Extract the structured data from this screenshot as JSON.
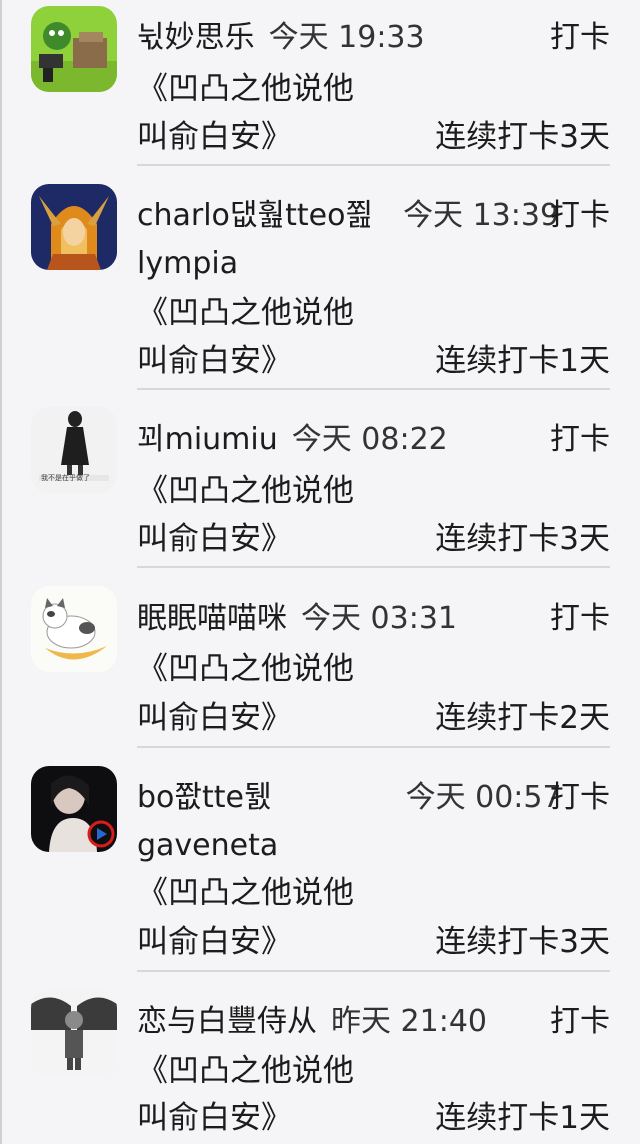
{
  "entries": [
    {
      "avatar_icon": "avatar-green-cartoon-icon",
      "name": "뉛妙思乐",
      "name_cont": "",
      "time": "今天 19:33",
      "action": "打卡",
      "book_line1": "《凹凸之他说他",
      "book_line2": "叫俞白安》",
      "streak": "连续打卡3天"
    },
    {
      "avatar_icon": "avatar-fantasy-portrait-icon",
      "name": "charlo댒훮tteo쬞",
      "name_cont": "lympia",
      "time": "今天 13:39",
      "action": "打卡",
      "book_line1": "《凹凸之他说他",
      "book_line2": "叫俞白安》",
      "streak": "连续打卡1天"
    },
    {
      "avatar_icon": "avatar-figure-sketch-icon",
      "name": "꾀miumiu",
      "name_cont": "",
      "time": "今天 08:22",
      "action": "打卡",
      "book_line1": "《凹凸之他说他",
      "book_line2": "叫俞白安》",
      "streak": "连续打卡3天"
    },
    {
      "avatar_icon": "avatar-cat-on-moon-icon",
      "name": "眠眠喵喵咪",
      "name_cont": "",
      "time": "今天 03:31",
      "action": "打卡",
      "book_line1": "《凹凸之他说他",
      "book_line2": "叫俞白安》",
      "streak": "连续打卡2天"
    },
    {
      "avatar_icon": "avatar-dark-portrait-video-icon",
      "name": "bo쫪tte뒔",
      "name_cont": "gaveneta",
      "time": "今天 00:57",
      "action": "打卡",
      "book_line1": "《凹凸之他说他",
      "book_line2": "叫俞白安》",
      "streak": "连续打卡3天"
    },
    {
      "avatar_icon": "avatar-grey-figure-icon",
      "name": "恋与白豐侍从",
      "name_cont": "",
      "time": "昨天 21:40",
      "action": "打卡",
      "book_line1": "《凹凸之他说他",
      "book_line2": "叫俞白安》",
      "streak": "连续打卡1天"
    }
  ]
}
